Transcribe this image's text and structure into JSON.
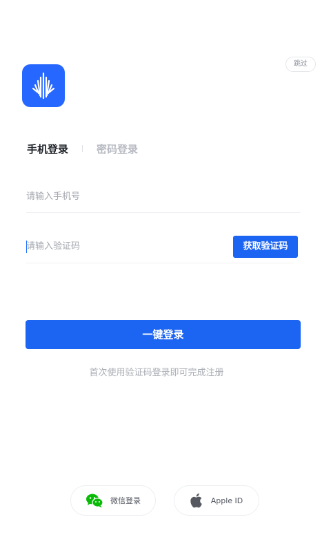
{
  "header": {
    "skip_label": "跳过"
  },
  "tabs": [
    {
      "label": "手机登录",
      "active": true
    },
    {
      "label": "密码登录",
      "active": false
    }
  ],
  "form": {
    "phone_placeholder": "请输入手机号",
    "code_placeholder": "请输入验证码",
    "get_code_label": "获取验证码",
    "submit_label": "一键登录",
    "hint": "首次使用验证码登录即可完成注册"
  },
  "third_party": [
    {
      "label": "微信登录",
      "icon": "wechat-icon"
    },
    {
      "label": "Apple ID",
      "icon": "apple-icon"
    }
  ],
  "colors": {
    "primary": "#1c64f2",
    "logo_bg": "#2667ff",
    "wechat": "#09bb07"
  }
}
